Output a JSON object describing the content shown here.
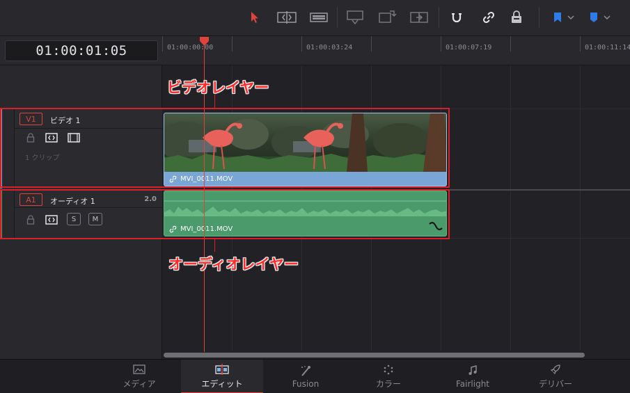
{
  "toolbar": {
    "icons": [
      "selection-arrow-icon",
      "trim-mode-icon",
      "blade-icon",
      "insert-clip-icon",
      "overwrite-clip-icon",
      "replace-clip-icon",
      "snapping-icon",
      "linked-selection-icon",
      "position-lock-icon",
      "flag-icon",
      "marker-icon"
    ],
    "accent_color": "#e0433c",
    "flag_color": "#2f7be8"
  },
  "timecode": "01:00:01:05",
  "ruler": {
    "labels": [
      "01:00:00:00",
      "01:00:03:24",
      "01:00:07:19",
      "01:00:11:14"
    ]
  },
  "tracks": {
    "video": {
      "id": "V1",
      "name": "ビデオ 1",
      "clip_count": "1 クリップ",
      "clip_name": "MVI_0011.MOV",
      "color": "#79a6d4"
    },
    "audio": {
      "id": "A1",
      "name": "オーディオ 1",
      "channels": "2.0",
      "solo": "S",
      "mute": "M",
      "clip_name": "MVI_0011.MOV",
      "color": "#4a9a6b"
    }
  },
  "annotations": {
    "video_layer": "ビデオレイヤー",
    "audio_layer": "オーディオレイヤー",
    "color": "#d8202b"
  },
  "pages": {
    "active": "エディット",
    "tabs": [
      {
        "label": "メディア",
        "icon": "media-page-icon"
      },
      {
        "label": "エディット",
        "icon": "edit-page-icon"
      },
      {
        "label": "Fusion",
        "icon": "fusion-page-icon"
      },
      {
        "label": "カラー",
        "icon": "color-page-icon"
      },
      {
        "label": "Fairlight",
        "icon": "fairlight-page-icon"
      },
      {
        "label": "デリバー",
        "icon": "deliver-page-icon"
      }
    ]
  }
}
